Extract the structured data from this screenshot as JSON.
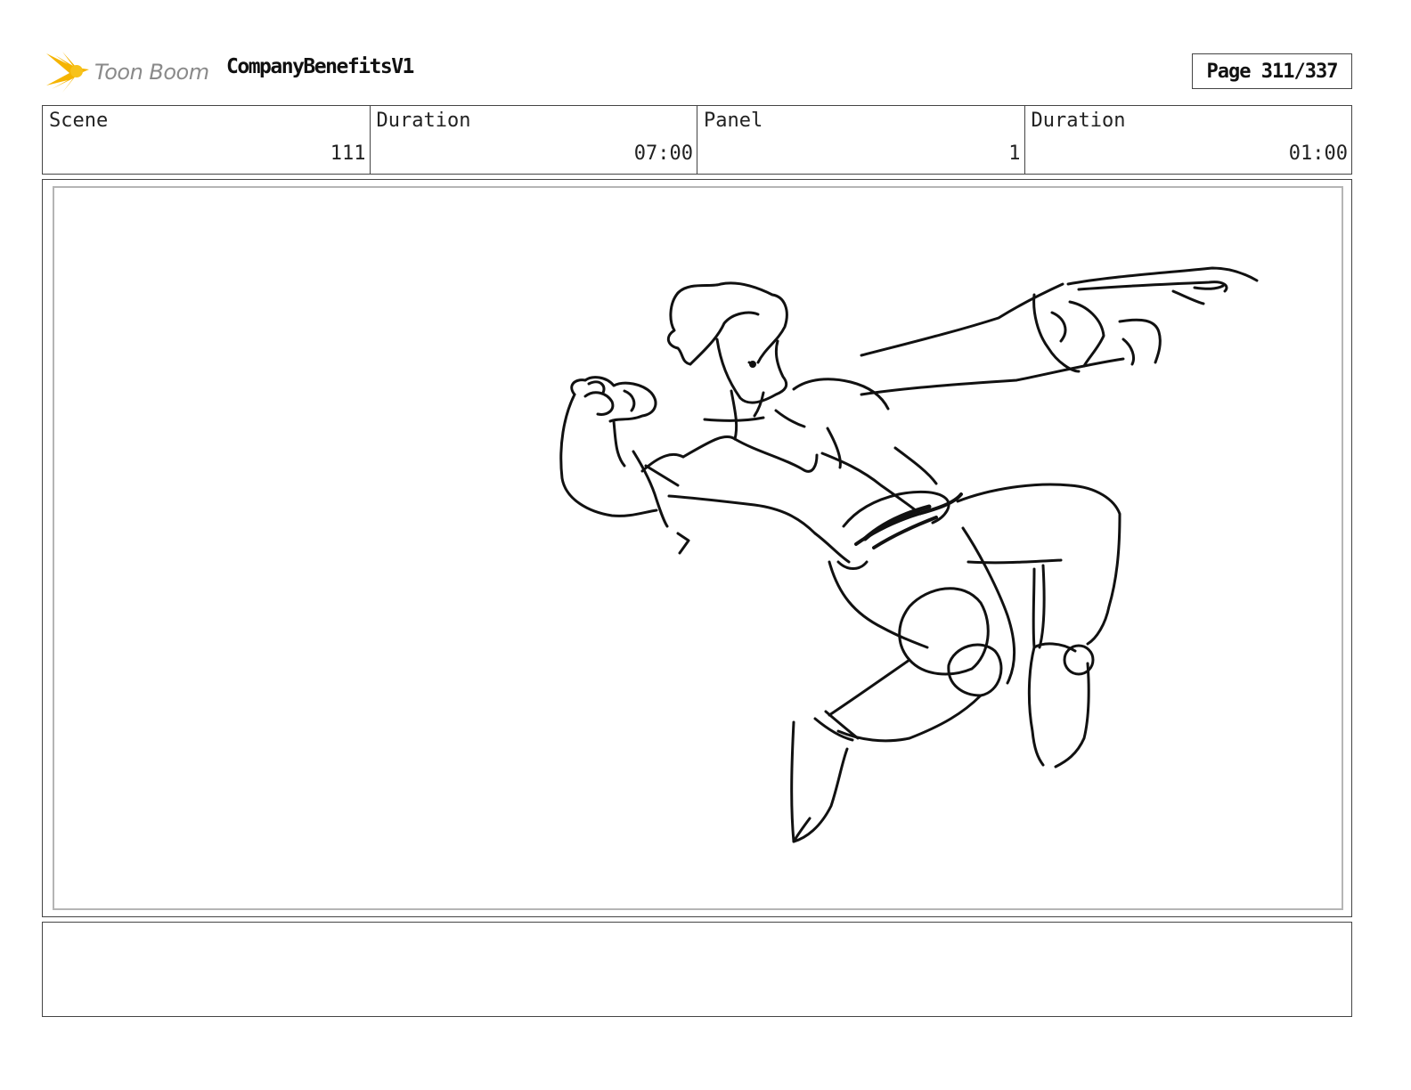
{
  "header": {
    "logo_text": "Toon Boom",
    "project_title": "CompanyBenefitsV1",
    "page_label": "Page 311/337"
  },
  "info": {
    "scene_label": "Scene",
    "scene_value": "111",
    "scene_duration_label": "Duration",
    "scene_duration_value": "07:00",
    "panel_label": "Panel",
    "panel_value": "1",
    "panel_duration_label": "Duration",
    "panel_duration_value": "01:00"
  },
  "colors": {
    "logo_star": "#f5b400",
    "logo_text": "#8a8a8a",
    "border": "#444444",
    "inner_border": "#b5b5b5"
  },
  "icons": {
    "logo": "toon-boom-star-icon"
  },
  "notes": {
    "text": ""
  }
}
